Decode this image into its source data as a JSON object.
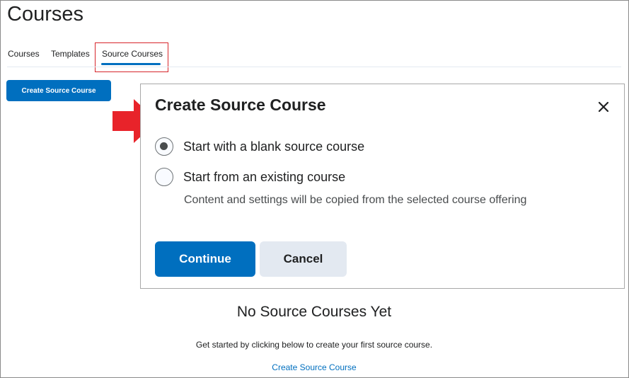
{
  "page": {
    "title": "Courses"
  },
  "tabs": [
    {
      "label": "Courses",
      "selected": false
    },
    {
      "label": "Templates",
      "selected": false
    },
    {
      "label": "Source Courses",
      "selected": true
    }
  ],
  "toolbar": {
    "create_label": "Create Source Course"
  },
  "dialog": {
    "title": "Create Source Course",
    "close_icon": "close-icon",
    "options": [
      {
        "label": "Start with a blank source course",
        "checked": true
      },
      {
        "label": "Start from an existing course",
        "checked": false
      }
    ],
    "option_description": "Content and settings will be copied from the selected course offering",
    "continue_label": "Continue",
    "cancel_label": "Cancel"
  },
  "empty_state": {
    "title": "No Source Courses Yet",
    "text": "Get started by clicking below to create your first source course.",
    "link_label": "Create Source Course"
  },
  "annotations": {
    "arrow_icon": "red-arrow-icon",
    "highlight_color": "#d7262b"
  },
  "colors": {
    "primary": "#006fbf",
    "secondary_button": "#e3e9f1",
    "text": "#202122"
  }
}
